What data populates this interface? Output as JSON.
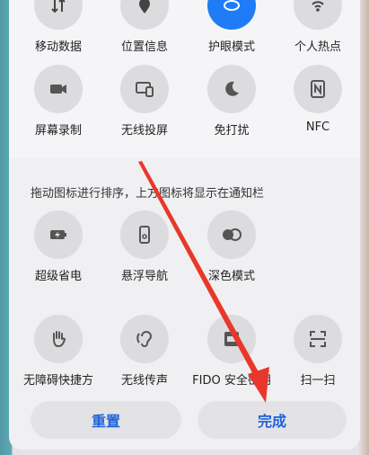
{
  "row1": [
    {
      "label": "移动数据",
      "icon": "arrows-icon"
    },
    {
      "label": "位置信息",
      "icon": "location-icon"
    },
    {
      "label": "护眼模式",
      "icon": "eye-icon"
    },
    {
      "label": "个人热点",
      "icon": "hotspot-icon"
    }
  ],
  "row2": [
    {
      "label": "屏幕录制",
      "icon": "camera-icon"
    },
    {
      "label": "无线投屏",
      "icon": "cast-icon"
    },
    {
      "label": "免打扰",
      "icon": "moon-icon"
    },
    {
      "label": "NFC",
      "icon": "nfc-icon"
    }
  ],
  "hint": "拖动图标进行排序，上方图标将显示在通知栏",
  "row3": [
    {
      "label": "超级省电",
      "icon": "battery-icon"
    },
    {
      "label": "悬浮导航",
      "icon": "floating-nav-icon"
    },
    {
      "label": "深色模式",
      "icon": "dark-mode-icon"
    }
  ],
  "row4": [
    {
      "label": "无障碍快捷方",
      "icon": "hand-icon"
    },
    {
      "label": "无线传声",
      "icon": "ear-icon"
    },
    {
      "label": "FIDO 安全密钥",
      "icon": "fido-icon"
    },
    {
      "label": "扫一扫",
      "icon": "scan-icon"
    }
  ],
  "buttons": {
    "reset": "重置",
    "done": "完成"
  },
  "colors": {
    "accent": "#1f7cf6",
    "arrow": "#e8382b"
  }
}
